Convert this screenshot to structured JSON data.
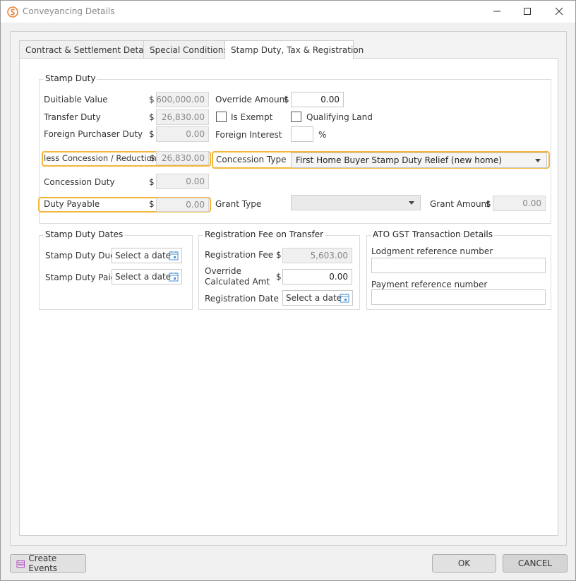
{
  "window": {
    "title": "Conveyancing Details"
  },
  "tabs": [
    {
      "label": "Contract & Settlement Details"
    },
    {
      "label": "Special Conditions"
    },
    {
      "label": "Stamp Duty, Tax & Registration"
    }
  ],
  "currency_symbol": "$",
  "stamp_duty": {
    "title": "Stamp Duty",
    "dutiable_value": {
      "label": "Duitiable Value",
      "value": "600,000.00"
    },
    "transfer_duty": {
      "label": "Transfer Duty",
      "value": "26,830.00"
    },
    "foreign_purchaser_duty": {
      "label": "Foreign Purchaser Duty",
      "value": "0.00"
    },
    "less_concession": {
      "label": "less Concession / Reduction",
      "value": "26,830.00"
    },
    "concession_duty": {
      "label": "Concession Duty",
      "value": "0.00"
    },
    "duty_payable": {
      "label": "Duty Payable",
      "value": "0.00"
    },
    "override_amount": {
      "label": "Override Amount",
      "value": "0.00"
    },
    "is_exempt": {
      "label": "Is Exempt",
      "checked": false
    },
    "qualifying_land": {
      "label": "Qualifying Land",
      "checked": false
    },
    "foreign_interest": {
      "label": "Foreign Interest",
      "value": "",
      "unit": "%"
    },
    "concession_type": {
      "label": "Concession Type",
      "value": "First Home Buyer Stamp Duty Relief (new home)"
    },
    "grant_type": {
      "label": "Grant Type",
      "value": ""
    },
    "grant_amount": {
      "label": "Grant Amount",
      "value": "0.00"
    }
  },
  "stamp_duty_dates": {
    "title": "Stamp Duty Dates",
    "due": {
      "label": "Stamp Duty Due",
      "placeholder": "Select a date"
    },
    "paid": {
      "label": "Stamp Duty Paid",
      "placeholder": "Select a date"
    }
  },
  "registration": {
    "title": "Registration Fee on Transfer",
    "fee": {
      "label": "Registration Fee",
      "value": "5,603.00"
    },
    "override_line1": "Override",
    "override_line2": "Calculated Amt",
    "override_value": "0.00",
    "date": {
      "label": "Registration Date",
      "placeholder": "Select a date"
    }
  },
  "ato": {
    "title": "ATO GST Transaction Details",
    "lodgment": {
      "label": "Lodgment reference number",
      "value": ""
    },
    "payment": {
      "label": "Payment reference number",
      "value": ""
    }
  },
  "footer": {
    "create_events": "Create Events",
    "ok": "OK",
    "cancel": "CANCEL"
  },
  "colors": {
    "highlight": "#f3b53a",
    "app_icon": "#e8833a",
    "calendar_icon": "#4a90d9",
    "events_icon": "#b04ec4"
  }
}
